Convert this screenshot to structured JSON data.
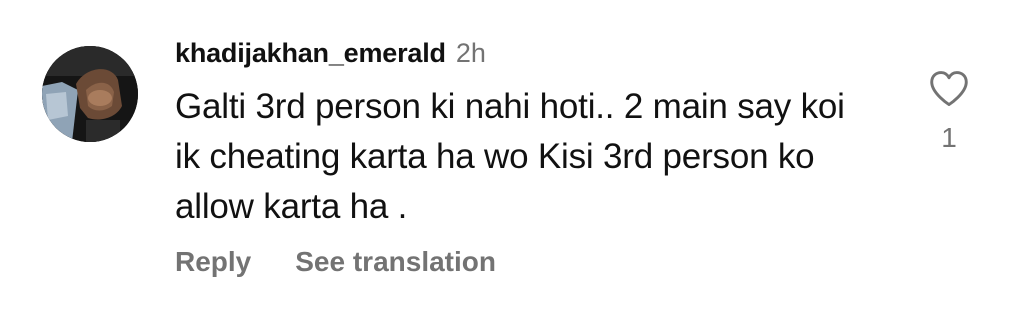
{
  "comment": {
    "username": "khadijakhan_emerald",
    "time": "2h",
    "text": "Galti 3rd person ki nahi hoti.. 2 main say koi ik cheating karta ha wo Kisi 3rd person ko allow karta ha .",
    "like_count": "1",
    "reply_label": "Reply",
    "translate_label": "See translation"
  },
  "icons": {
    "avatar": "profile-photo",
    "like": "heart-outline-icon"
  },
  "colors": {
    "text_primary": "#111111",
    "text_secondary": "#737373",
    "background": "#ffffff"
  }
}
